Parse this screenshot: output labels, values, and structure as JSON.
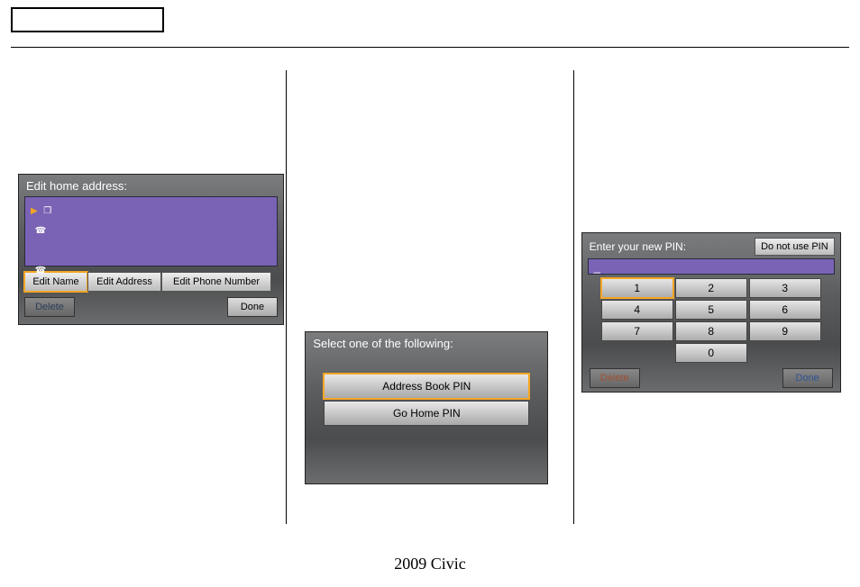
{
  "footer": "2009  Civic",
  "screen1": {
    "title": "Edit home address:",
    "rows": [
      {
        "indicator": "▶",
        "icon": "❐"
      },
      {
        "indicator": "",
        "icon": "☎"
      },
      {
        "indicator": "",
        "icon": ""
      },
      {
        "indicator": "",
        "icon": "☎"
      }
    ],
    "buttons": {
      "edit_name": "Edit Name",
      "edit_address": "Edit Address",
      "edit_phone": "Edit Phone Number"
    },
    "delete": "Delete",
    "done": "Done"
  },
  "screen2": {
    "title": "Select one of the following:",
    "items": {
      "address_book_pin": "Address Book PIN",
      "go_home_pin": "Go Home PIN"
    }
  },
  "screen3": {
    "title": "Enter your new PIN:",
    "no_pin": "Do not use PIN",
    "entry_cursor": "_",
    "keys": [
      "1",
      "2",
      "3",
      "4",
      "5",
      "6",
      "7",
      "8",
      "9",
      "0"
    ],
    "delete": "Delete",
    "done": "Done"
  }
}
